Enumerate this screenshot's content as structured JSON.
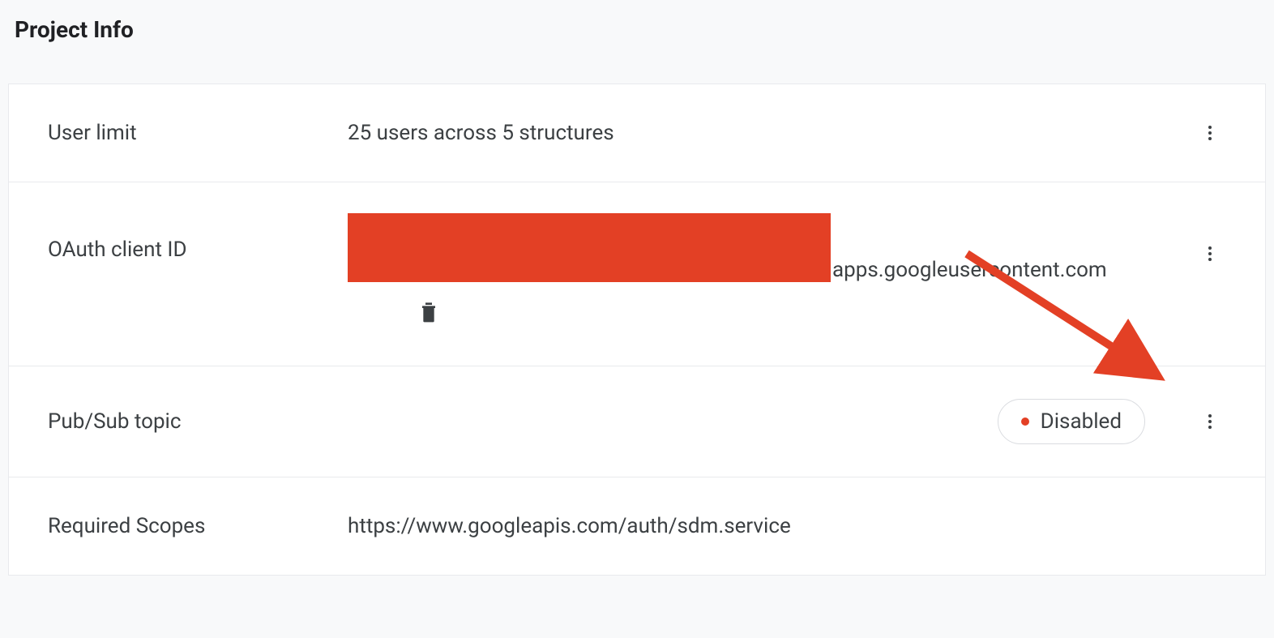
{
  "header": {
    "title": "Project Info"
  },
  "rows": {
    "user_limit": {
      "label": "User limit",
      "value": "25 users across 5 structures"
    },
    "oauth": {
      "label": "OAuth client ID",
      "redacted": true,
      "suffix": "apps.googleusercontent.com"
    },
    "pubsub": {
      "label": "Pub/Sub topic",
      "status_text": "Disabled",
      "status_color": "#e34025"
    },
    "scopes": {
      "label": "Required Scopes",
      "value": "https://www.googleapis.com/auth/sdm.service"
    }
  },
  "annotation": {
    "arrow_color": "#e34025"
  }
}
